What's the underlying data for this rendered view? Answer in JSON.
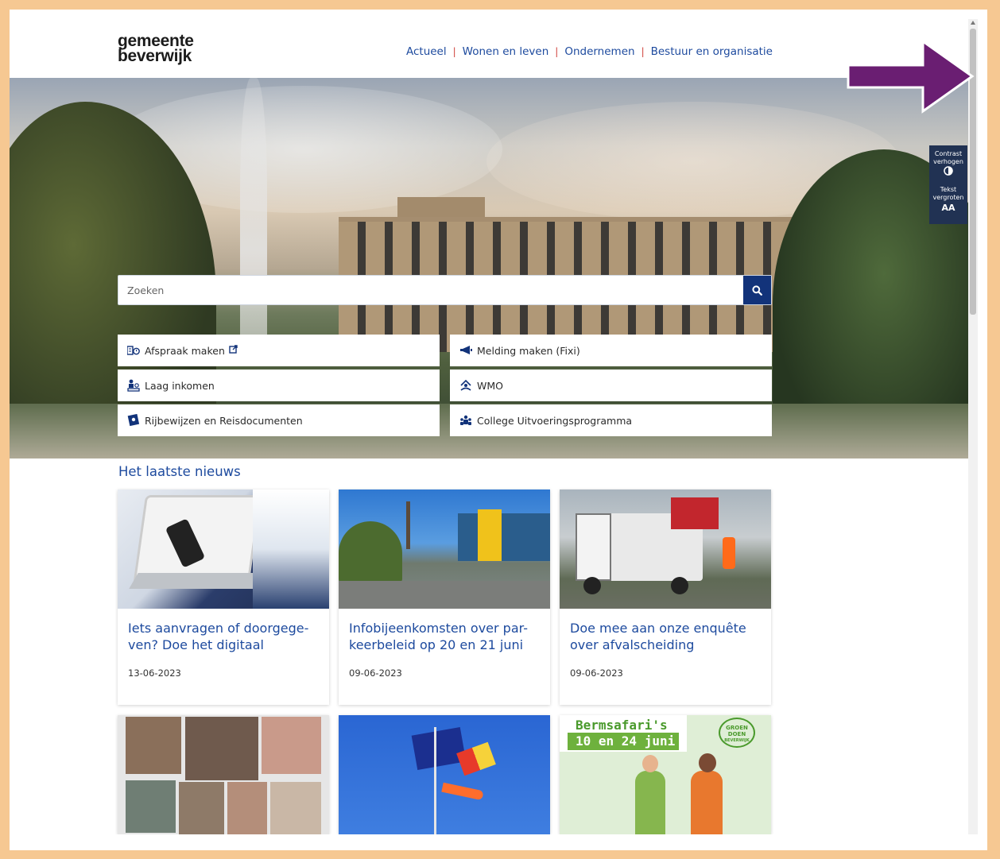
{
  "logo": {
    "line1": "gemeente",
    "line2": "beverwijk"
  },
  "nav": {
    "items": [
      "Actueel",
      "Wonen en leven",
      "Ondernemen",
      "Bestuur en organisatie"
    ],
    "separator": "|"
  },
  "search": {
    "placeholder": "Zoeken"
  },
  "quick_links": [
    {
      "label": "Afspraak maken",
      "icon": "appointment-icon",
      "external": true
    },
    {
      "label": "Melding maken (Fixi)",
      "icon": "megaphone-icon"
    },
    {
      "label": "Laag inkomen",
      "icon": "income-icon"
    },
    {
      "label": "WMO",
      "icon": "care-icon"
    },
    {
      "label": "Rijbewijzen en Reisdocumenten",
      "icon": "license-icon"
    },
    {
      "label": "College Uitvoeringsprogramma",
      "icon": "program-icon"
    }
  ],
  "accessibility": {
    "contrast_line1": "Contrast",
    "contrast_line2": "verhogen",
    "text_line1": "Tekst",
    "text_line2": "vergroten",
    "text_symbol": "AA"
  },
  "news": {
    "heading": "Het laatste nieuws",
    "cards": [
      {
        "title": "Iets aanvragen of doorgege-ven? Doe het digitaal",
        "date": "13-06-2023"
      },
      {
        "title": "Infobijeenkomsten over par-keerbeleid op 20 en 21 juni",
        "date": "09-06-2023"
      },
      {
        "title": "Doe mee aan onze enquête over afvalscheiding",
        "date": "09-06-2023"
      },
      {
        "title": "",
        "date": ""
      },
      {
        "title": "",
        "date": ""
      },
      {
        "title": "",
        "date": ""
      }
    ],
    "bermsafari_title": "Bermsafari's",
    "bermsafari_dates": "10 en 24 juni",
    "groen_doen_line1": "GROEN",
    "groen_doen_line2": "DOEN",
    "groen_doen_line3": "BEVERWIJK"
  },
  "colors": {
    "brand_blue": "#1d4a9e",
    "search_button": "#12337a",
    "separator_red": "#d0403b",
    "toolbar_bg": "#213253",
    "annotation_arrow": "#6a1e72",
    "frame": "#f6c892"
  }
}
